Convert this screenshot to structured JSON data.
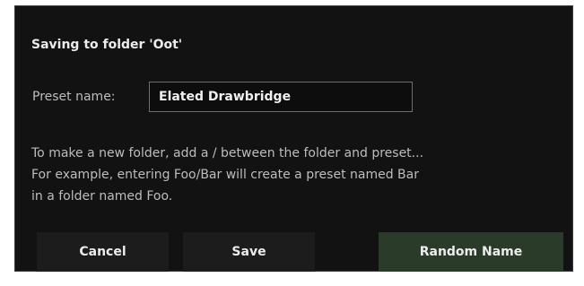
{
  "dialog": {
    "title": "Saving to folder 'Oot'",
    "preset_label": "Preset name:",
    "preset_value": "Elated Drawbridge",
    "help_lines": [
      "To make a new folder, add a / between the folder and preset...",
      "For example, entering Foo/Bar will create a preset named Bar",
      "in a folder named Foo."
    ],
    "buttons": {
      "cancel": "Cancel",
      "save": "Save",
      "random": "Random Name"
    }
  },
  "colors": {
    "background": "#121212",
    "input_border": "#6e6e6e",
    "button": "#1c1c1c",
    "accent_button": "#2a3b2a"
  }
}
